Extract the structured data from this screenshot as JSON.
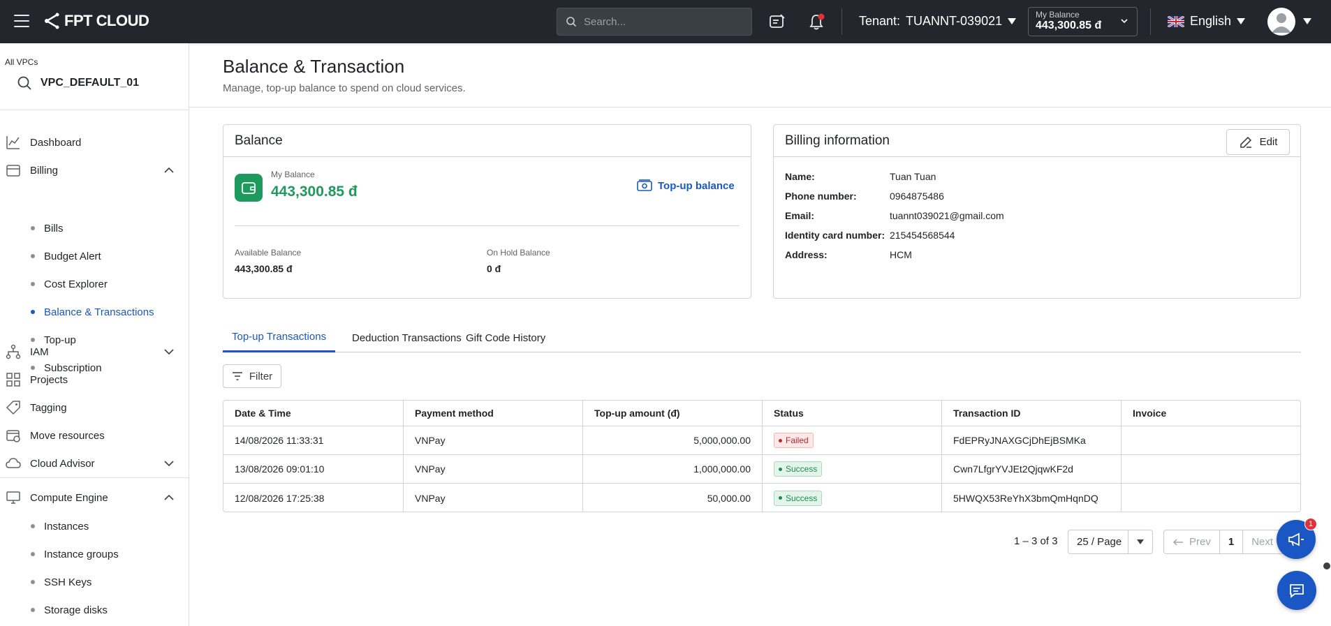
{
  "header": {
    "brand": "FPT CLOUD",
    "search_placeholder": "Search...",
    "tenant_label": "Tenant:",
    "tenant_value": "TUANNT-039021",
    "balance_label": "My Balance",
    "balance_value": "443,300.85 đ",
    "language": "English"
  },
  "sidebar": {
    "vpc_scope": "All VPCs",
    "vpc_name": "VPC_DEFAULT_01",
    "items": [
      {
        "label": "Dashboard",
        "icon": "chart-icon"
      },
      {
        "label": "Billing",
        "icon": "wallet-icon"
      },
      {
        "label": "IAM",
        "icon": "org-icon"
      },
      {
        "label": "Projects",
        "icon": "grid-icon"
      },
      {
        "label": "Tagging",
        "icon": "tag-icon"
      },
      {
        "label": "Move resources",
        "icon": "move-icon"
      },
      {
        "label": "Cloud Advisor",
        "icon": "cloud-icon"
      },
      {
        "label": "Compute Engine",
        "icon": "monitor-icon"
      }
    ],
    "billing_sub": [
      "Bills",
      "Budget Alert",
      "Cost Explorer",
      "Balance & Transactions",
      "Top-up",
      "Subscription"
    ],
    "compute_sub": [
      "Instances",
      "Instance groups",
      "SSH Keys",
      "Storage disks"
    ]
  },
  "page": {
    "title": "Balance & Transaction",
    "subtitle": "Manage, top-up balance to spend on cloud services."
  },
  "balance_card": {
    "title": "Balance",
    "my_balance_label": "My Balance",
    "my_balance_value": "443,300.85 đ",
    "topup_label": "Top-up balance",
    "available_label": "Available Balance",
    "available_value": "443,300.85 đ",
    "onhold_label": "On Hold Balance",
    "onhold_value": "0 đ"
  },
  "billing_card": {
    "title": "Billing information",
    "edit_label": "Edit",
    "rows": [
      {
        "k": "Name:",
        "v": "Tuan Tuan"
      },
      {
        "k": "Phone number:",
        "v": "0964875486"
      },
      {
        "k": "Email:",
        "v": "tuannt039021@gmail.com"
      },
      {
        "k": "Identity card number:",
        "v": "215454568544"
      },
      {
        "k": "Address:",
        "v": "HCM"
      }
    ]
  },
  "tabs": [
    "Top-up Transactions",
    "Deduction Transactions",
    "Gift Code History"
  ],
  "filter_label": "Filter",
  "table": {
    "columns": [
      "Date & Time",
      "Payment method",
      "Top-up amount (đ)",
      "Status",
      "Transaction ID",
      "Invoice"
    ],
    "rows": [
      {
        "date": "14/08/2026 11:33:31",
        "method": "VNPay",
        "amount": "5,000,000.00",
        "status": "Failed",
        "txid": "FdEPRyJNAXGCjDhEjBSMKa",
        "invoice": ""
      },
      {
        "date": "13/08/2026 09:01:10",
        "method": "VNPay",
        "amount": "1,000,000.00",
        "status": "Success",
        "txid": "Cwn7LfgrYVJEt2QjqwKF2d",
        "invoice": ""
      },
      {
        "date": "12/08/2026 17:25:38",
        "method": "VNPay",
        "amount": "50,000.00",
        "status": "Success",
        "txid": "5HWQX53ReYhX3bmQmHqnDQ",
        "invoice": ""
      }
    ]
  },
  "pagination": {
    "range": "1 – 3 of 3",
    "per_page": "25 / Page",
    "prev": "Prev",
    "page": "1",
    "next": "Next"
  },
  "notification_count": "1",
  "colors": {
    "accent": "#1a56c4",
    "success": "#1e9a5e",
    "topbar": "#23272d"
  }
}
